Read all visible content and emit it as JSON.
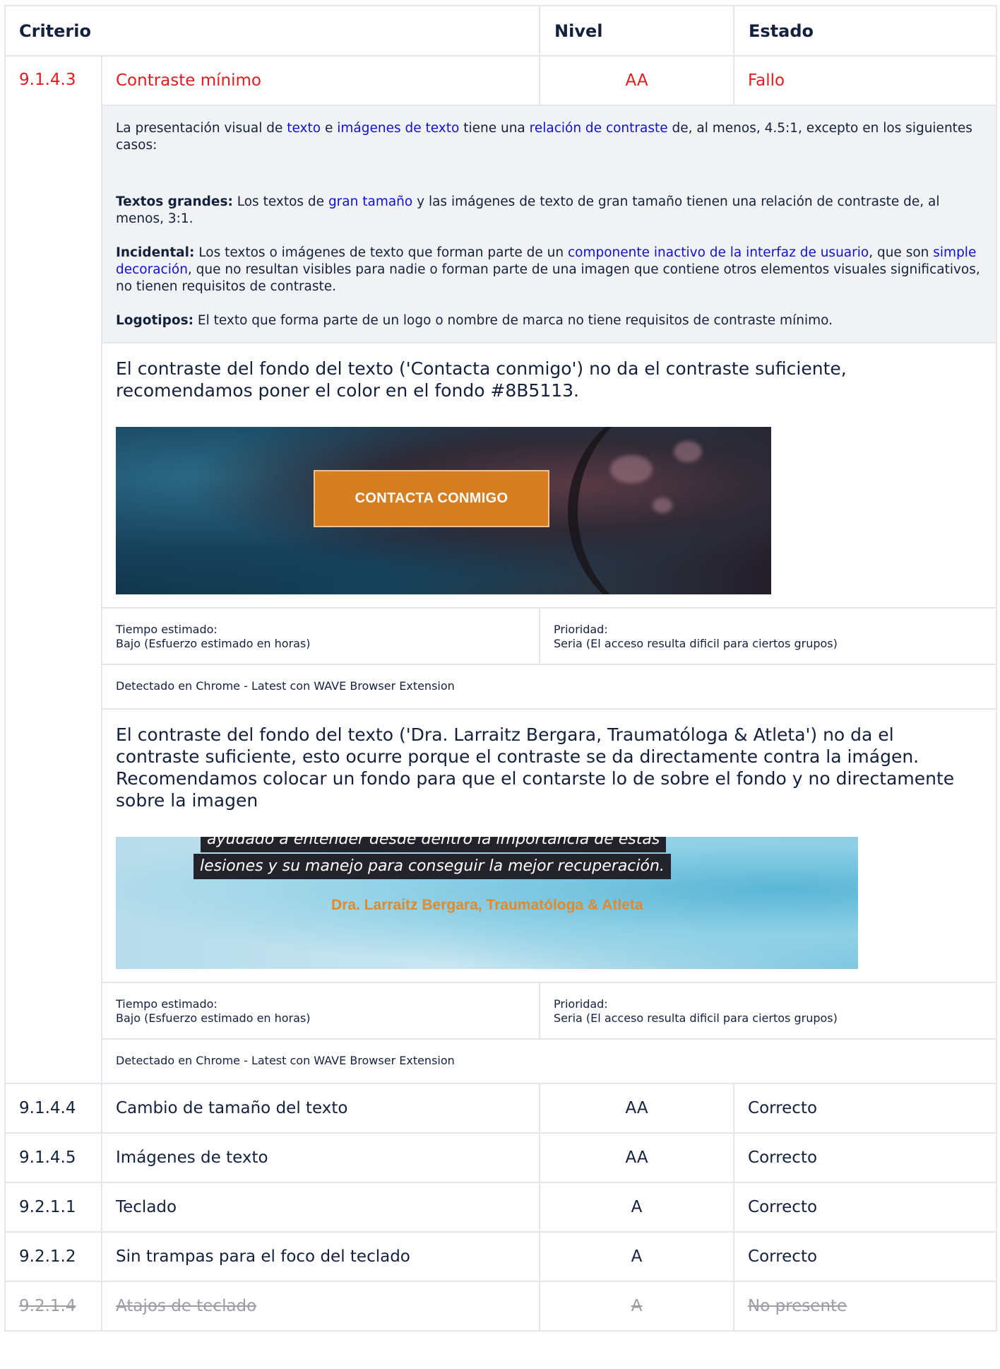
{
  "headers": {
    "criterion": "Criterio",
    "level": "Nivel",
    "status": "Estado"
  },
  "failed": {
    "code": "9.1.4.3",
    "name": "Contraste mínimo",
    "level": "AA",
    "status": "Fallo",
    "description": {
      "p1": [
        "La presentación visual de ",
        "texto",
        " e ",
        "imágenes de texto",
        " tiene una ",
        "relación de contraste",
        " de, al menos, 4.5:1, excepto en los siguientes casos:"
      ],
      "large_label": "Textos grandes:",
      "large": [
        " Los textos de ",
        "gran tamaño",
        " y las imágenes de texto de gran tamaño tienen una relación de contraste de, al menos, 3:1."
      ],
      "incidental_label": "Incidental:",
      "incidental": [
        " Los textos o imágenes de texto que forman parte de un ",
        "componente inactivo de la interfaz de usuario",
        ", que son ",
        "simple decoración",
        ", que no resultan visibles para nadie o forman parte de una imagen que contiene otros elementos visuales significativos, no tienen requisitos de contraste."
      ],
      "logos_label": "Logotipos:",
      "logos": " El texto que forma parte de un logo o nombre de marca no tiene requisitos de contraste mínimo."
    },
    "issues": [
      {
        "text": "El contraste del fondo del texto ('Contacta conmigo') no da el contraste suficiente, recomendamos poner el color en el fondo #8B5113.",
        "image_button": "CONTACTA CONMIGO",
        "time_label": "Tiempo estimado:",
        "time_value": "Bajo (Esfuerzo estimado en horas)",
        "priority_label": "Prioridad:",
        "priority_value": "Seria (El acceso resulta dificil para ciertos grupos)",
        "detected": "Detectado en Chrome - Latest con WAVE Browser Extension"
      },
      {
        "text": "El contraste del fondo del texto ('Dra. Larraitz Bergara, Traumatóloga & Atleta') no da el contraste suficiente, esto ocurre porque el contraste se da directamente contra la imágen. Recomendamos colocar un fondo para que el contarste lo de sobre el fondo y no directamente sobre la imagen",
        "image_line1": "ayudado a entender desde dentro la importancia de estas",
        "image_line2": "lesiones y su manejo para conseguir la mejor recuperación.",
        "image_sign": "Dra. Larraitz Bergara, Traumatóloga & Atleta",
        "time_label": "Tiempo estimado:",
        "time_value": "Bajo (Esfuerzo estimado en horas)",
        "priority_label": "Prioridad:",
        "priority_value": "Seria (El acceso resulta dificil para ciertos grupos)",
        "detected": "Detectado en Chrome - Latest con WAVE Browser Extension"
      }
    ]
  },
  "rows": [
    {
      "code": "9.1.4.4",
      "name": "Cambio de tamaño del texto",
      "level": "AA",
      "status": "Correcto"
    },
    {
      "code": "9.1.4.5",
      "name": "Imágenes de texto",
      "level": "AA",
      "status": "Correcto"
    },
    {
      "code": "9.2.1.1",
      "name": "Teclado",
      "level": "A",
      "status": "Correcto"
    },
    {
      "code": "9.2.1.2",
      "name": "Sin trampas para el foco del teclado",
      "level": "A",
      "status": "Correcto"
    },
    {
      "code": "9.2.1.4",
      "name": "Atajos de teclado",
      "level": "A",
      "status": "No presente"
    }
  ],
  "colors": {
    "fail": "#e8191e",
    "link": "#1010d6",
    "absent": "#9a9ea3",
    "desc_bg": "#f0f2f4"
  }
}
